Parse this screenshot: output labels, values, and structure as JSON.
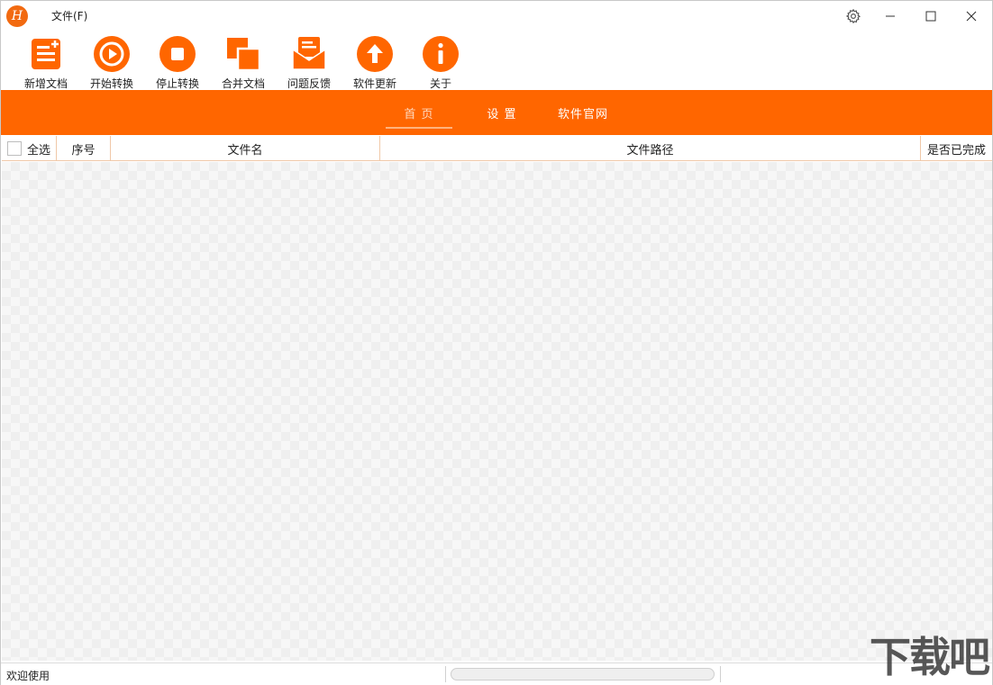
{
  "app": {
    "logo_letter": "H",
    "menu_file": "文件(F)"
  },
  "toolbar": [
    {
      "label": "新增文档",
      "icon": "add-document-icon"
    },
    {
      "label": "开始转换",
      "icon": "play-icon"
    },
    {
      "label": "停止转换",
      "icon": "stop-icon"
    },
    {
      "label": "合并文档",
      "icon": "merge-icon"
    },
    {
      "label": "问题反馈",
      "icon": "feedback-icon"
    },
    {
      "label": "软件更新",
      "icon": "update-icon"
    },
    {
      "label": "关于",
      "icon": "info-icon"
    }
  ],
  "nav": {
    "tabs": [
      "首  页",
      "设  置",
      "软件官网"
    ],
    "active": 0
  },
  "table": {
    "columns": [
      "全选",
      "序号",
      "文件名",
      "文件路径",
      "是否已完成"
    ],
    "rows": []
  },
  "status": {
    "message": "欢迎使用",
    "progress": 0
  },
  "watermark": "下载吧",
  "colors": {
    "accent": "#ff6600"
  }
}
